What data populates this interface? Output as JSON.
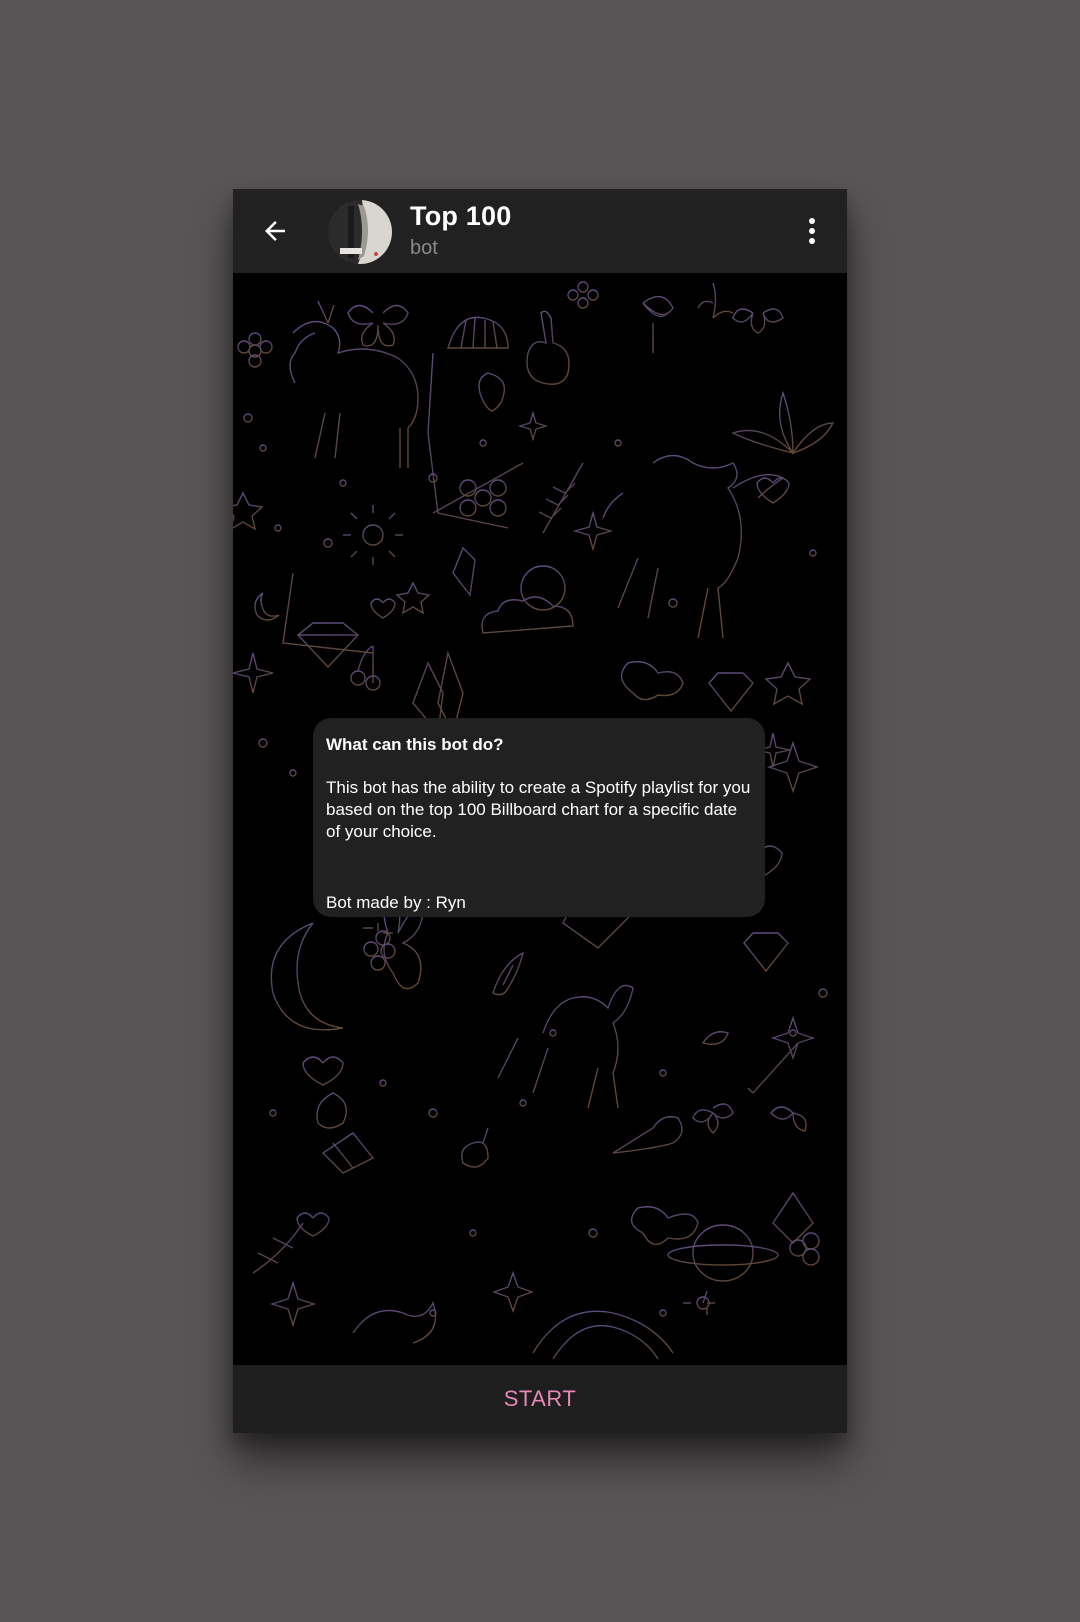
{
  "header": {
    "title": "Top 100",
    "subtitle": "bot",
    "back_icon": "arrow-left-icon",
    "menu_icon": "more-vertical-icon"
  },
  "intro_message": {
    "heading": "What can this bot do?",
    "body": "This bot has the ability to create a Spotify playlist for you based on the top 100 Billboard chart for a specific date of your choice.",
    "credit": "Bot made by : Ryn"
  },
  "footer": {
    "start_label": "START"
  },
  "colors": {
    "page_background": "#595557",
    "header_background": "#212121",
    "chat_background": "#000000",
    "bubble_background": "#212121",
    "accent": "#e588b5",
    "doodle_purple": "#6e5a94",
    "doodle_brown": "#6b4f3c"
  }
}
